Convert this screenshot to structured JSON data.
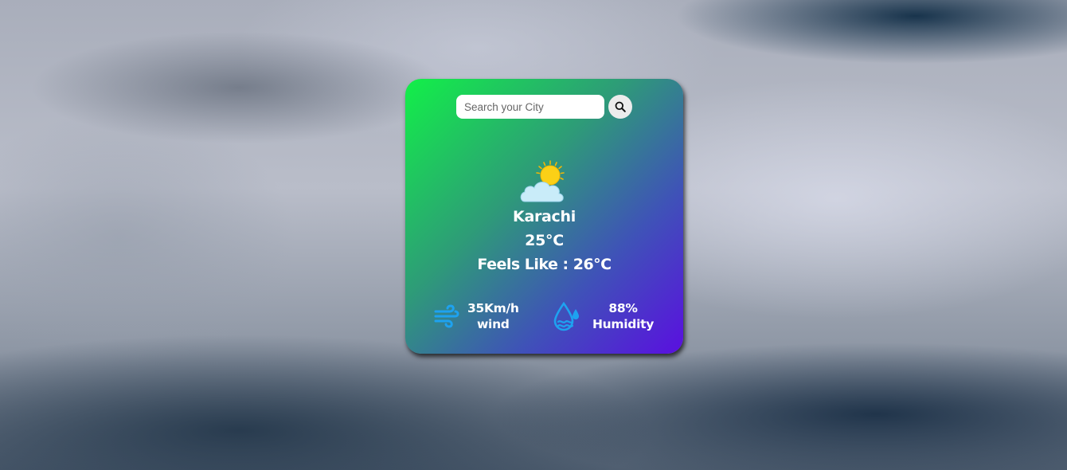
{
  "search": {
    "placeholder": "Search your City",
    "button_icon": "search-icon"
  },
  "weather": {
    "icon": "partly-cloudy-icon",
    "city": "Karachi",
    "temperature": "25°C",
    "feels_like": "Feels Like : 26°C"
  },
  "stats": {
    "wind": {
      "icon": "wind-icon",
      "value": "35Km/h",
      "label": "wind"
    },
    "humidity": {
      "icon": "humidity-icon",
      "value": "88%",
      "label": "Humidity"
    }
  },
  "colors": {
    "card_gradient_start": "#12f048",
    "card_gradient_end": "#5a0fe0",
    "icon_blue": "#1ea2f0",
    "sun_yellow": "#fbd017"
  }
}
